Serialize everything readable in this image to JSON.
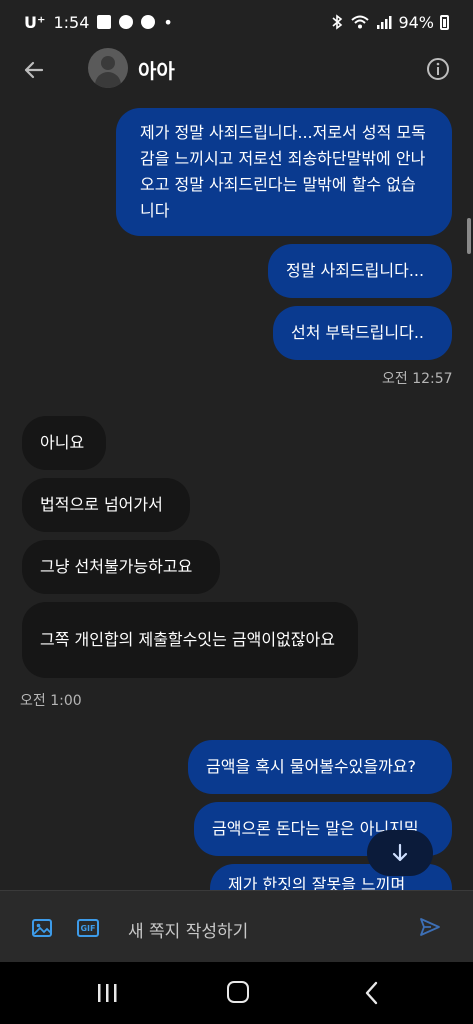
{
  "status_bar": {
    "carrier": "U⁺",
    "time": "1:54",
    "dot": "•",
    "battery": "94%"
  },
  "header": {
    "title": "아아"
  },
  "messages": [
    {
      "side": "out",
      "text": "제가 정말 사죄드립니다...저로서 성적 모독감을 느끼시고 저로선 죄송하단말밖에 안나오고 정말 사죄드린다는 말밖에 할수 없습니다"
    },
    {
      "side": "out",
      "text": "정말 사죄드립니다..."
    },
    {
      "side": "out",
      "text": "선처 부탁드립니다.."
    },
    {
      "side": "in",
      "text": "아니요"
    },
    {
      "side": "in",
      "text": "법적으로 넘어가서"
    },
    {
      "side": "in",
      "text": "그냥 선처불가능하고요"
    },
    {
      "side": "in",
      "text": "그쪽 개인합의 제출할수잇는 금액이없잖아요"
    },
    {
      "side": "out",
      "text": "금액을 혹시 물어볼수있을까요?"
    },
    {
      "side": "out",
      "text": "금액으론 돈다는 말은 아니지밀"
    },
    {
      "side": "out",
      "text": "제가 한짓의 잘못을 느끼며"
    }
  ],
  "timestamps": {
    "t1": "오전 12:57",
    "t2": "오전 1:00"
  },
  "composer": {
    "gif_label": "GIF",
    "placeholder": "새 쪽지 작성하기"
  },
  "colors": {
    "outgoing_bubble": "#0a3a8f",
    "incoming_bubble": "#161616",
    "accent": "#3d9be9"
  }
}
